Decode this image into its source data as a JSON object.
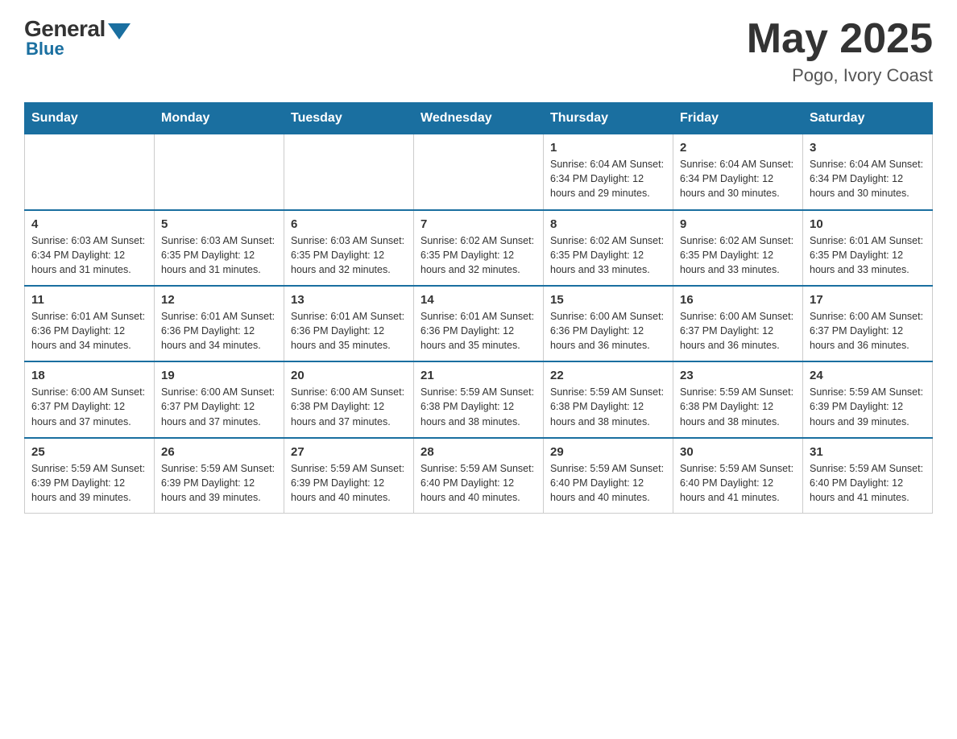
{
  "header": {
    "logo_general": "General",
    "logo_blue": "Blue",
    "month_year": "May 2025",
    "location": "Pogo, Ivory Coast"
  },
  "days_of_week": [
    "Sunday",
    "Monday",
    "Tuesday",
    "Wednesday",
    "Thursday",
    "Friday",
    "Saturday"
  ],
  "weeks": [
    [
      {
        "day": "",
        "info": ""
      },
      {
        "day": "",
        "info": ""
      },
      {
        "day": "",
        "info": ""
      },
      {
        "day": "",
        "info": ""
      },
      {
        "day": "1",
        "info": "Sunrise: 6:04 AM\nSunset: 6:34 PM\nDaylight: 12 hours and 29 minutes."
      },
      {
        "day": "2",
        "info": "Sunrise: 6:04 AM\nSunset: 6:34 PM\nDaylight: 12 hours and 30 minutes."
      },
      {
        "day": "3",
        "info": "Sunrise: 6:04 AM\nSunset: 6:34 PM\nDaylight: 12 hours and 30 minutes."
      }
    ],
    [
      {
        "day": "4",
        "info": "Sunrise: 6:03 AM\nSunset: 6:34 PM\nDaylight: 12 hours and 31 minutes."
      },
      {
        "day": "5",
        "info": "Sunrise: 6:03 AM\nSunset: 6:35 PM\nDaylight: 12 hours and 31 minutes."
      },
      {
        "day": "6",
        "info": "Sunrise: 6:03 AM\nSunset: 6:35 PM\nDaylight: 12 hours and 32 minutes."
      },
      {
        "day": "7",
        "info": "Sunrise: 6:02 AM\nSunset: 6:35 PM\nDaylight: 12 hours and 32 minutes."
      },
      {
        "day": "8",
        "info": "Sunrise: 6:02 AM\nSunset: 6:35 PM\nDaylight: 12 hours and 33 minutes."
      },
      {
        "day": "9",
        "info": "Sunrise: 6:02 AM\nSunset: 6:35 PM\nDaylight: 12 hours and 33 minutes."
      },
      {
        "day": "10",
        "info": "Sunrise: 6:01 AM\nSunset: 6:35 PM\nDaylight: 12 hours and 33 minutes."
      }
    ],
    [
      {
        "day": "11",
        "info": "Sunrise: 6:01 AM\nSunset: 6:36 PM\nDaylight: 12 hours and 34 minutes."
      },
      {
        "day": "12",
        "info": "Sunrise: 6:01 AM\nSunset: 6:36 PM\nDaylight: 12 hours and 34 minutes."
      },
      {
        "day": "13",
        "info": "Sunrise: 6:01 AM\nSunset: 6:36 PM\nDaylight: 12 hours and 35 minutes."
      },
      {
        "day": "14",
        "info": "Sunrise: 6:01 AM\nSunset: 6:36 PM\nDaylight: 12 hours and 35 minutes."
      },
      {
        "day": "15",
        "info": "Sunrise: 6:00 AM\nSunset: 6:36 PM\nDaylight: 12 hours and 36 minutes."
      },
      {
        "day": "16",
        "info": "Sunrise: 6:00 AM\nSunset: 6:37 PM\nDaylight: 12 hours and 36 minutes."
      },
      {
        "day": "17",
        "info": "Sunrise: 6:00 AM\nSunset: 6:37 PM\nDaylight: 12 hours and 36 minutes."
      }
    ],
    [
      {
        "day": "18",
        "info": "Sunrise: 6:00 AM\nSunset: 6:37 PM\nDaylight: 12 hours and 37 minutes."
      },
      {
        "day": "19",
        "info": "Sunrise: 6:00 AM\nSunset: 6:37 PM\nDaylight: 12 hours and 37 minutes."
      },
      {
        "day": "20",
        "info": "Sunrise: 6:00 AM\nSunset: 6:38 PM\nDaylight: 12 hours and 37 minutes."
      },
      {
        "day": "21",
        "info": "Sunrise: 5:59 AM\nSunset: 6:38 PM\nDaylight: 12 hours and 38 minutes."
      },
      {
        "day": "22",
        "info": "Sunrise: 5:59 AM\nSunset: 6:38 PM\nDaylight: 12 hours and 38 minutes."
      },
      {
        "day": "23",
        "info": "Sunrise: 5:59 AM\nSunset: 6:38 PM\nDaylight: 12 hours and 38 minutes."
      },
      {
        "day": "24",
        "info": "Sunrise: 5:59 AM\nSunset: 6:39 PM\nDaylight: 12 hours and 39 minutes."
      }
    ],
    [
      {
        "day": "25",
        "info": "Sunrise: 5:59 AM\nSunset: 6:39 PM\nDaylight: 12 hours and 39 minutes."
      },
      {
        "day": "26",
        "info": "Sunrise: 5:59 AM\nSunset: 6:39 PM\nDaylight: 12 hours and 39 minutes."
      },
      {
        "day": "27",
        "info": "Sunrise: 5:59 AM\nSunset: 6:39 PM\nDaylight: 12 hours and 40 minutes."
      },
      {
        "day": "28",
        "info": "Sunrise: 5:59 AM\nSunset: 6:40 PM\nDaylight: 12 hours and 40 minutes."
      },
      {
        "day": "29",
        "info": "Sunrise: 5:59 AM\nSunset: 6:40 PM\nDaylight: 12 hours and 40 minutes."
      },
      {
        "day": "30",
        "info": "Sunrise: 5:59 AM\nSunset: 6:40 PM\nDaylight: 12 hours and 41 minutes."
      },
      {
        "day": "31",
        "info": "Sunrise: 5:59 AM\nSunset: 6:40 PM\nDaylight: 12 hours and 41 minutes."
      }
    ]
  ]
}
